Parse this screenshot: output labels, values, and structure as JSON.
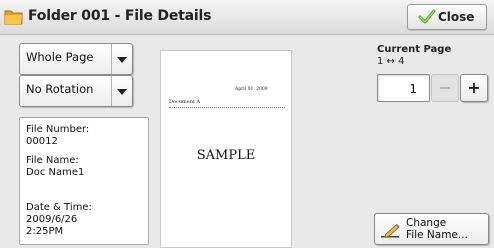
{
  "title_bar": {
    "title": "Folder 001 - File Details",
    "folder_icon": "folder-icon",
    "close_label": "Close",
    "close_icon": "check-icon"
  },
  "controls": {
    "page_view": {
      "selected": "Whole Page"
    },
    "rotation": {
      "selected": "No Rotation"
    }
  },
  "file_info": {
    "file_number_label": "File Number:",
    "file_number": "00012",
    "file_name_label": "File Name:",
    "file_name": "Doc Name1",
    "date_time_label": "Date & Time:",
    "date": "2009/6/26",
    "time": "2:25PM"
  },
  "preview": {
    "date_line": "April 01, 2009",
    "document_heading": "Document A",
    "sample_text": "SAMPLE"
  },
  "paging": {
    "current_page_label": "Current Page",
    "range": "1 ↔ 4",
    "page_value": "1",
    "minus_label": "−",
    "plus_label": "+"
  },
  "change_file_name": {
    "line1": "Change",
    "line2": "File Name...",
    "icon": "pencil-icon"
  },
  "colors": {
    "folder": "#f5b82e",
    "check": "#7cc23a"
  }
}
